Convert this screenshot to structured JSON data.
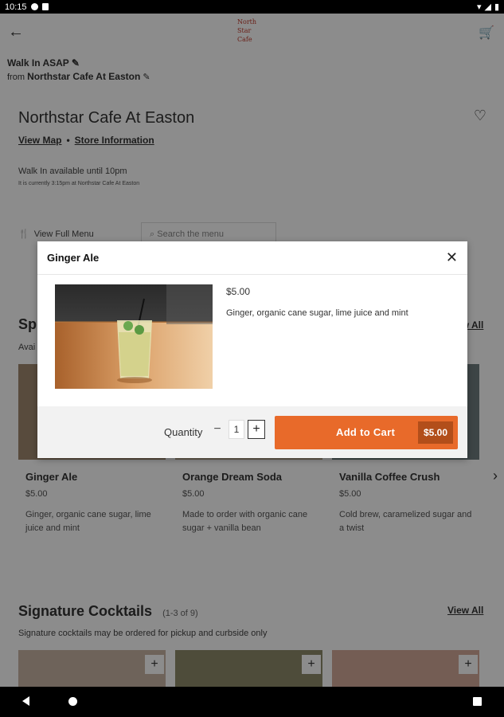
{
  "status_bar": {
    "time": "10:15"
  },
  "header": {
    "walk_label": "Walk In ASAP",
    "from_prefix": "from",
    "from_location": "Northstar Cafe At Easton",
    "logo_line1": "North",
    "logo_line2": "Star",
    "logo_line3": "Cafe"
  },
  "store": {
    "name": "Northstar Cafe At Easton",
    "view_map": "View Map",
    "separator": "•",
    "store_info": "Store Information",
    "walkin_available": "Walk In available until 10pm",
    "current_time": "It is currently 3:15pm at Northstar Cafe At Easton"
  },
  "menu": {
    "view_full_menu": "View Full Menu",
    "search_placeholder": "Search the menu"
  },
  "sections": {
    "spritzers_title": "Sp",
    "spritzers_sub": "Avai",
    "view_all": "View All",
    "cocktails_title": "Signature Cocktails",
    "cocktails_count": "(1-3 of 9)",
    "cocktails_view_all": "View All",
    "cocktails_sub": "Signature cocktails may be ordered for pickup and curbside only"
  },
  "cards": [
    {
      "name": "Ginger Ale",
      "price": "$5.00",
      "desc_line1": "Ginger, organic cane sugar, lime",
      "desc_line2": "juice and mint"
    },
    {
      "name": "Orange Dream Soda",
      "price": "$5.00",
      "desc_line1": "Made to order with organic cane",
      "desc_line2": "sugar + vanilla bean"
    },
    {
      "name": "Vanilla Coffee Crush",
      "price": "$5.00",
      "desc_line1": "Cold brew, caramelized sugar and",
      "desc_line2": "a twist"
    }
  ],
  "modal": {
    "title": "Ginger Ale",
    "price": "$5.00",
    "description": "Ginger, organic cane sugar, lime juice and mint",
    "quantity_label": "Quantity",
    "quantity_value": "1",
    "add_to_cart": "Add to Cart",
    "cart_price": "$5.00"
  },
  "colors": {
    "accent": "#e86a2a",
    "accent_dark": "#b24e1a"
  }
}
